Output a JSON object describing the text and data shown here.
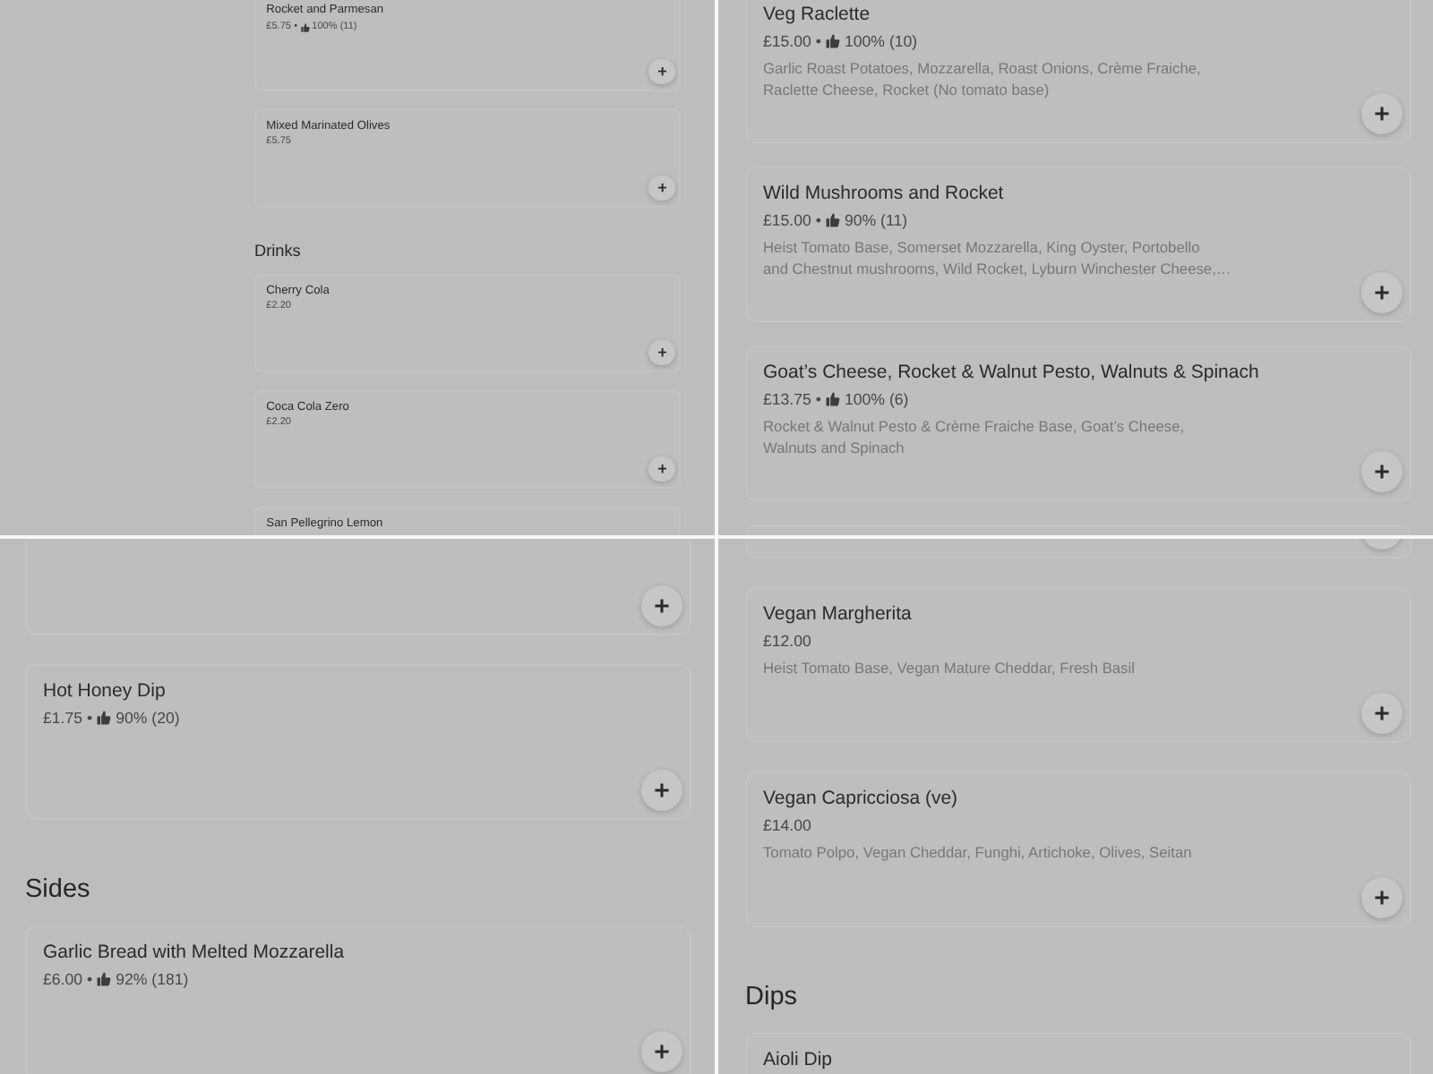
{
  "panels": [
    {
      "items": [
        {
          "kind": "card",
          "name": "Rocket and Parmesan",
          "price": "£5.75",
          "separator": "•",
          "rating": "100% (11)"
        },
        {
          "kind": "card",
          "name": "Mixed Marinated Olives",
          "price": "£5.75"
        },
        {
          "kind": "heading",
          "title": "Drinks"
        },
        {
          "kind": "card",
          "name": "Cherry Cola",
          "price": "£2.20"
        },
        {
          "kind": "card",
          "name": "Coca Cola Zero",
          "price": "£2.20"
        },
        {
          "kind": "card",
          "name": "San Pellegrino Lemon"
        }
      ]
    },
    {
      "items": [
        {
          "kind": "card",
          "name": "Veg Raclette",
          "price": "£15.00",
          "separator": "•",
          "rating": "100% (10)",
          "description": [
            "Garlic Roast Potatoes, Mozzarella, Roast Onions, Crème Fraiche,",
            "Raclette Cheese, Rocket (No tomato base)"
          ]
        },
        {
          "kind": "card",
          "name": "Wild Mushrooms and Rocket",
          "price": "£15.00",
          "separator": "•",
          "rating": "90% (11)",
          "description": [
            "Heist Tomato Base, Somerset Mozzarella, King Oyster, Portobello",
            "and Chestnut mushrooms, Wild Rocket, Lyburn Winchester Cheese,…"
          ]
        },
        {
          "kind": "card",
          "name": "Goat’s Cheese, Rocket & Walnut Pesto, Walnuts & Spinach",
          "price": "£13.75",
          "separator": "•",
          "rating": "100% (6)",
          "description": [
            "Rocket & Walnut Pesto & Crème Fraiche Base, Goat’s Cheese,",
            "Walnuts and Spinach"
          ]
        },
        {
          "kind": "card"
        }
      ]
    },
    {
      "items": [
        {
          "kind": "card"
        },
        {
          "kind": "card",
          "name": "Hot Honey Dip",
          "price": "£1.75",
          "separator": "•",
          "rating": "90% (20)"
        },
        {
          "kind": "heading",
          "title": "Sides"
        },
        {
          "kind": "card",
          "name": "Garlic Bread with Melted Mozzarella",
          "price": "£6.00",
          "separator": "•",
          "rating": "92% (181)"
        }
      ]
    },
    {
      "items": [
        {
          "kind": "card"
        },
        {
          "kind": "card",
          "name": "Vegan Margherita",
          "price": "£12.00",
          "description": [
            "Heist Tomato Base, Vegan Mature Cheddar, Fresh Basil"
          ]
        },
        {
          "kind": "card",
          "name": "Vegan Capricciosa (ve)",
          "price": "£14.00",
          "description": [
            "Tomato Polpo, Vegan Cheddar, Funghi, Artichoke, Olives, Seitan"
          ]
        },
        {
          "kind": "heading",
          "title": "Dips"
        },
        {
          "kind": "card",
          "name": "Aioli Dip"
        }
      ]
    }
  ]
}
